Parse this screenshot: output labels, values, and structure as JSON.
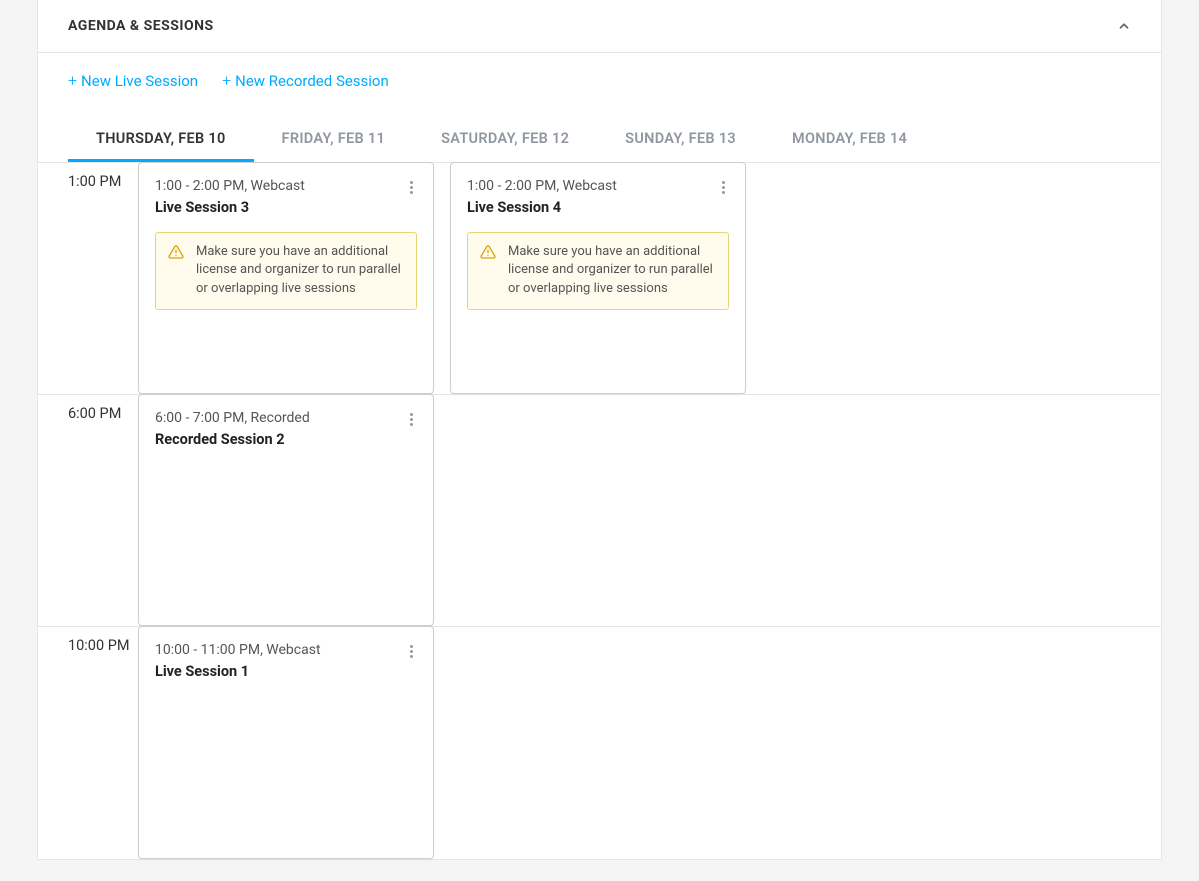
{
  "panel": {
    "title": "AGENDA & SESSIONS"
  },
  "actions": {
    "new_live": "New Live Session",
    "new_recorded": "New Recorded Session"
  },
  "tabs": [
    {
      "label": "THURSDAY, FEB 10",
      "active": true
    },
    {
      "label": "FRIDAY, FEB 11",
      "active": false
    },
    {
      "label": "SATURDAY, FEB 12",
      "active": false
    },
    {
      "label": "SUNDAY, FEB 13",
      "active": false
    },
    {
      "label": "MONDAY, FEB 14",
      "active": false
    }
  ],
  "timeslots": [
    {
      "label": "1:00 PM",
      "sessions": [
        {
          "meta": "1:00 - 2:00 PM, Webcast",
          "title": "Live Session 3",
          "warning": "Make sure you have an additional license and organizer to run parallel or overlapping live sessions"
        },
        {
          "meta": "1:00 - 2:00 PM, Webcast",
          "title": "Live Session 4",
          "warning": "Make sure you have an additional license and organizer to run parallel or overlapping live sessions"
        }
      ]
    },
    {
      "label": "6:00 PM",
      "sessions": [
        {
          "meta": "6:00 - 7:00 PM, Recorded",
          "title": "Recorded Session 2",
          "warning": null
        }
      ]
    },
    {
      "label": "10:00 PM",
      "sessions": [
        {
          "meta": "10:00 - 11:00 PM, Webcast",
          "title": "Live Session 1",
          "warning": null
        }
      ]
    }
  ]
}
